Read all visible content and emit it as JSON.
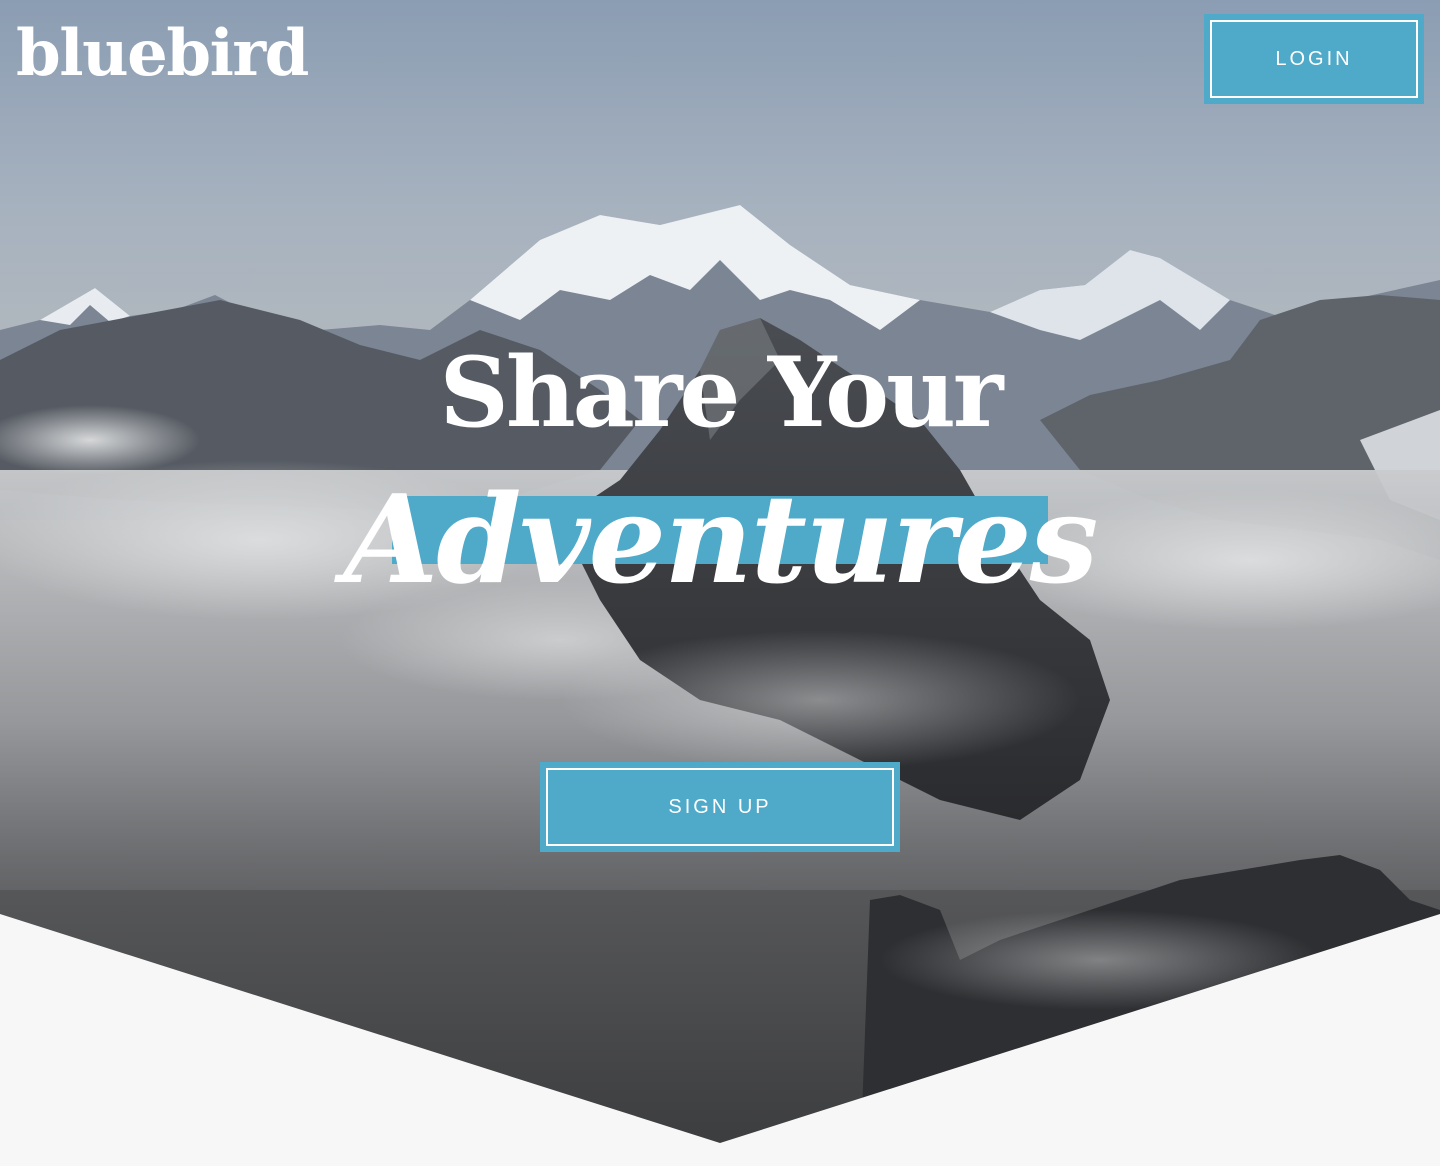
{
  "brand": {
    "name": "bluebird",
    "accent_color": "#4fa9c8",
    "page_background": "#f7f7f7"
  },
  "header": {
    "login_label": "LOGIN"
  },
  "hero": {
    "headline": "Share Your",
    "highlight_word": "Adventures",
    "cta_label": "SIGN UP",
    "background_image": "snowy-mountain-peaks-above-clouds"
  }
}
